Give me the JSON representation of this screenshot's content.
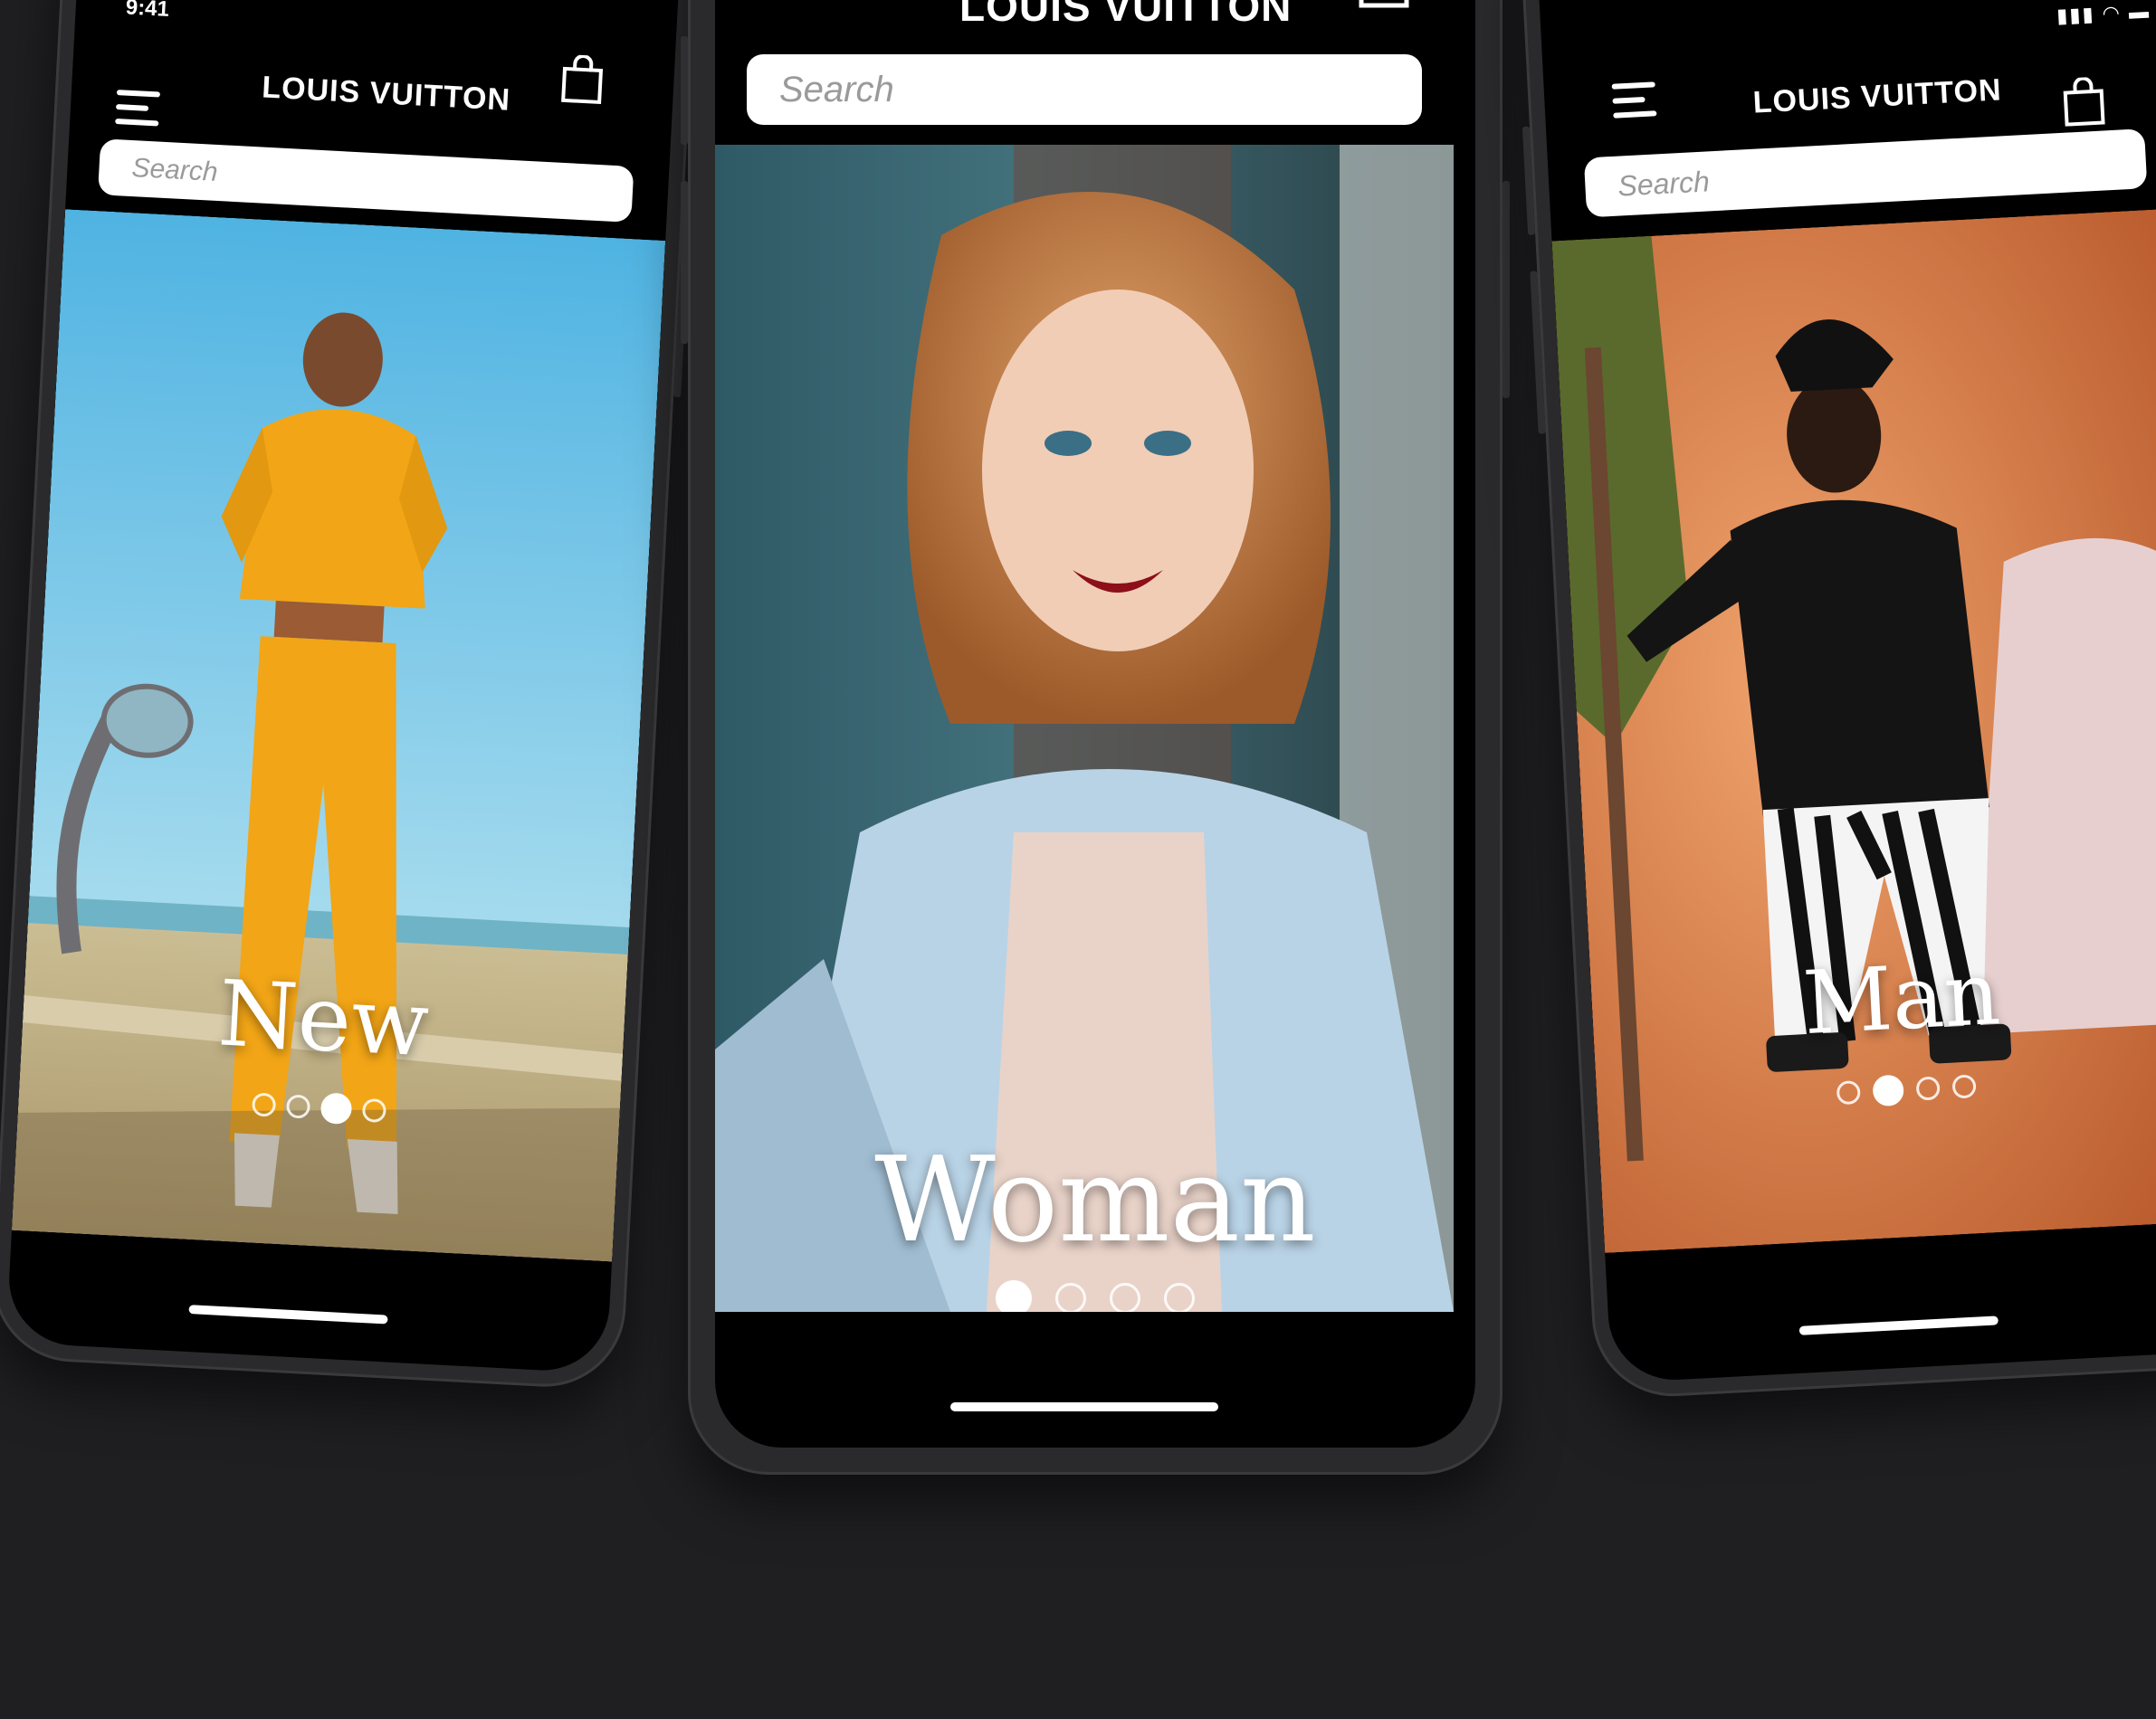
{
  "status": {
    "time": "9:41",
    "icons": "▮▮▮ ◠ ▬"
  },
  "brand": "LOUIS VUITTON",
  "search_placeholder": "Search",
  "phones": [
    {
      "label": "New",
      "dots": 4,
      "active_dot": 2
    },
    {
      "label": "Woman",
      "dots": 4,
      "active_dot": 0
    },
    {
      "label": "Man",
      "dots": 4,
      "active_dot": 1
    }
  ],
  "colors": {
    "background": "#1f1f22",
    "sky": "#6ec6e8",
    "tracksuit": "#f2a516",
    "jacket": "#b9d3e6",
    "hair": "#c4773a",
    "orange_backdrop": "#d8743f"
  }
}
